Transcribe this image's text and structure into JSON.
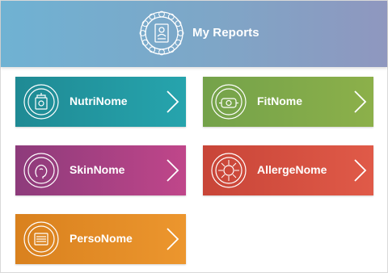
{
  "header": {
    "title": "My Reports",
    "icon": "report-document-icon"
  },
  "cards": [
    {
      "label": "NutriNome",
      "icon": "nutrition-bag-icon",
      "color": "#24a0aa"
    },
    {
      "label": "FitNome",
      "icon": "fitness-scale-icon",
      "color": "#86ad4a"
    },
    {
      "label": "SkinNome",
      "icon": "face-profile-icon",
      "color": "#b04385"
    },
    {
      "label": "AllergeNome",
      "icon": "pollen-icon",
      "color": "#d94f40"
    },
    {
      "label": "PersoNome",
      "icon": "personality-icon",
      "color": "#e68c28"
    }
  ],
  "chevron_icon": "chevron-right-icon"
}
